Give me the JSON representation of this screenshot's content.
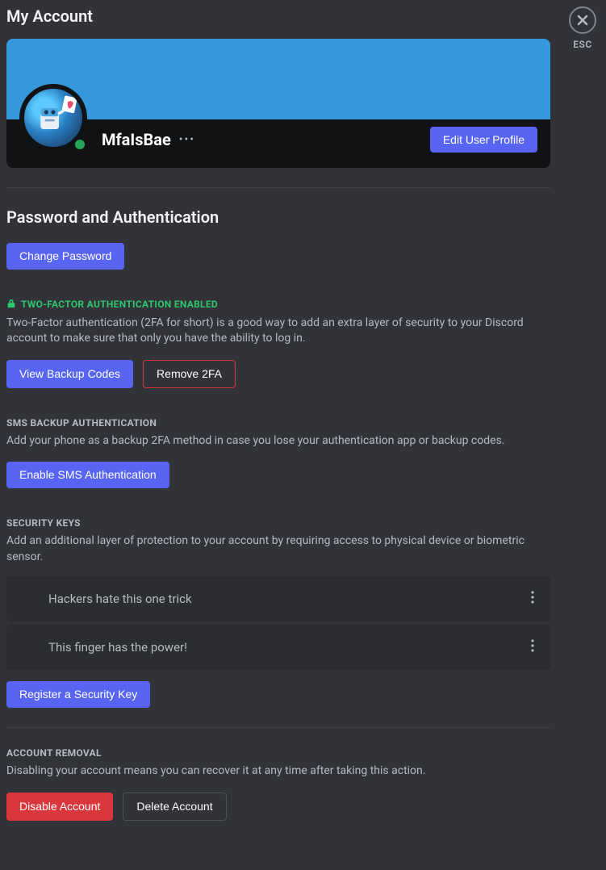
{
  "close": {
    "esc_label": "ESC"
  },
  "page_title": "My Account",
  "profile": {
    "username": "MfaIsBae",
    "edit_button": "Edit User Profile"
  },
  "auth": {
    "section_title": "Password and Authentication",
    "change_password": "Change Password",
    "twofa_header": "TWO-FACTOR AUTHENTICATION ENABLED",
    "twofa_desc": "Two-Factor authentication (2FA for short) is a good way to add an extra layer of security to your Discord account to make sure that only you have the ability to log in.",
    "view_backup": "View Backup Codes",
    "remove_2fa": "Remove 2FA",
    "sms_header": "SMS BACKUP AUTHENTICATION",
    "sms_desc": "Add your phone as a backup 2FA method in case you lose your authentication app or backup codes.",
    "enable_sms": "Enable SMS Authentication",
    "keys_header": "SECURITY KEYS",
    "keys_desc": "Add an additional layer of protection to your account by requiring access to physical device or biometric sensor.",
    "keys": [
      {
        "name": "Hackers hate this one trick"
      },
      {
        "name": "This finger has the power!"
      }
    ],
    "register_key": "Register a Security Key"
  },
  "removal": {
    "header": "ACCOUNT REMOVAL",
    "desc": "Disabling your account means you can recover it at any time after taking this action.",
    "disable": "Disable Account",
    "delete": "Delete Account"
  }
}
